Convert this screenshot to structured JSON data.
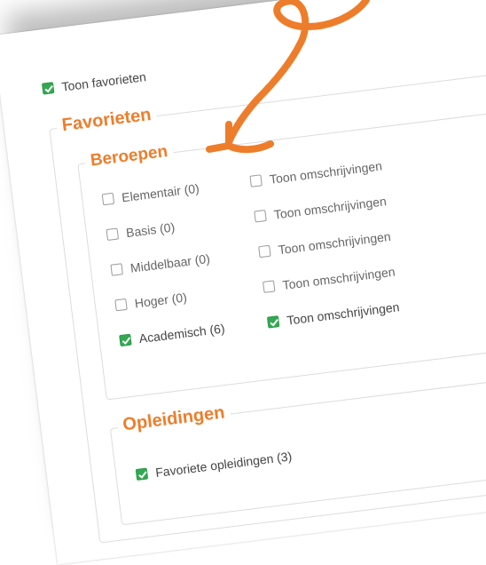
{
  "show_favorites": {
    "label": "Toon favorieten",
    "checked": true
  },
  "favorites": {
    "legend": "Favorieten",
    "occupations": {
      "legend": "Beroepen",
      "rows": [
        {
          "level": "Elementair (0)",
          "level_checked": false,
          "desc": "Toon omschrijvingen",
          "desc_checked": false
        },
        {
          "level": "Basis (0)",
          "level_checked": false,
          "desc": "Toon omschrijvingen",
          "desc_checked": false
        },
        {
          "level": "Middelbaar (0)",
          "level_checked": false,
          "desc": "Toon omschrijvingen",
          "desc_checked": false
        },
        {
          "level": "Hoger (0)",
          "level_checked": false,
          "desc": "Toon omschrijvingen",
          "desc_checked": false
        },
        {
          "level": "Academisch (6)",
          "level_checked": true,
          "desc": "Toon omschrijvingen",
          "desc_checked": true
        }
      ]
    },
    "educations": {
      "legend": "Opleidingen",
      "favorite_educations": {
        "label": "Favoriete opleidingen (3)",
        "checked": true
      }
    }
  },
  "colors": {
    "accent_orange": "#ee7d2b",
    "check_green": "#33a852"
  }
}
